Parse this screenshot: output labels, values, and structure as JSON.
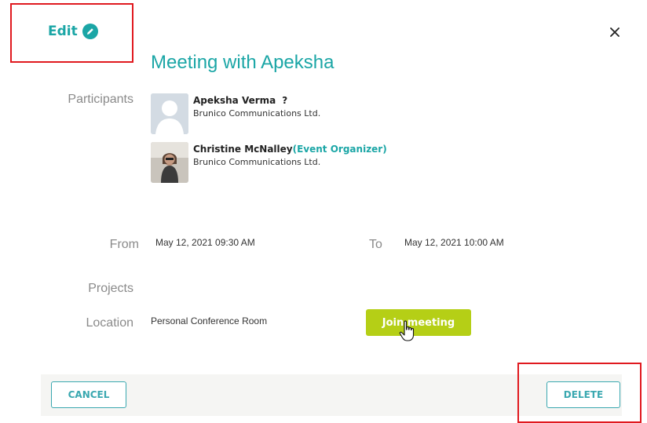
{
  "header": {
    "edit_label": "Edit",
    "title": "Meeting with Apeksha",
    "edit_icon": "pencil-icon",
    "close_icon": "close-icon"
  },
  "labels": {
    "participants": "Participants",
    "from": "From",
    "to": "To",
    "projects": "Projects",
    "location": "Location"
  },
  "participants": [
    {
      "name": "Apeksha Verma",
      "badge": "?",
      "role": "",
      "company": "Brunico Communications Ltd."
    },
    {
      "name": "Christine McNalley",
      "badge": "",
      "role": "(Event Organizer)",
      "company": "Brunico Communications Ltd."
    }
  ],
  "schedule": {
    "from": "May 12, 2021 09:30 AM",
    "to": "May 12, 2021 10:00 AM"
  },
  "location": {
    "value": "Personal Conference Room",
    "join_label": "Join meeting"
  },
  "footer": {
    "cancel_label": "CANCEL",
    "delete_label": "DELETE"
  },
  "colors": {
    "accent": "#1ba6a6",
    "join_button": "#b5cf16",
    "highlight": "#e0191f"
  }
}
